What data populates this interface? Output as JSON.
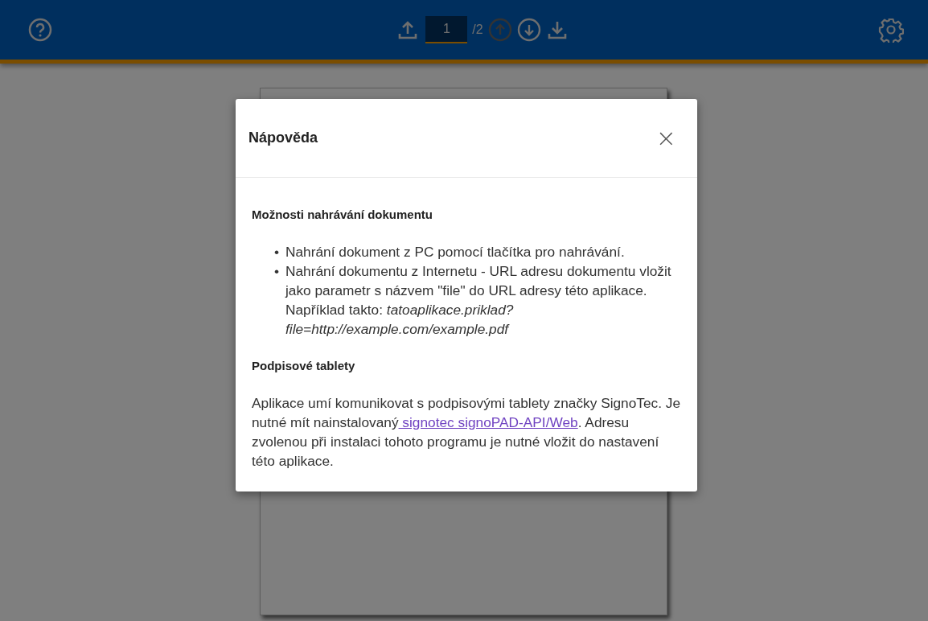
{
  "toolbar": {
    "page_input": {
      "value": "1"
    },
    "page_total": "/2",
    "nav": [
      {
        "kind": "up",
        "disabled": true
      },
      {
        "kind": "down",
        "disabled": false
      }
    ]
  },
  "dialog": {
    "title": "Nápověda",
    "close": "×",
    "sections": [
      {
        "heading": "Možnosti nahrávání dokumentu",
        "kind": "list",
        "items": [
          {
            "marker": "•",
            "text": "Nahrání dokument z PC pomocí tlačítka pro nahrávání."
          },
          {
            "marker": "•",
            "text": "Nahrání dokumentu z Internetu - URL adresu dokumentu vložit jako parametr s názvem \"file\" do URL adresy této aplikace. Například takto: *tatoaplikace.priklad?file=http://example.com/example.pdf*"
          }
        ]
      },
      {
        "heading": "Podpisové tablety",
        "kind": "paragraph",
        "text_before": "Aplikace umí komunikovat s podpisovými tablety značky SignoTec. Je nutné mít nainstalovaný",
        "link": " signotec signoPAD-API/Web",
        "text_after": ". Adresu zvolenou při instalaci tohoto programu je nutné vložit do nastavení této aplikace."
      }
    ]
  }
}
